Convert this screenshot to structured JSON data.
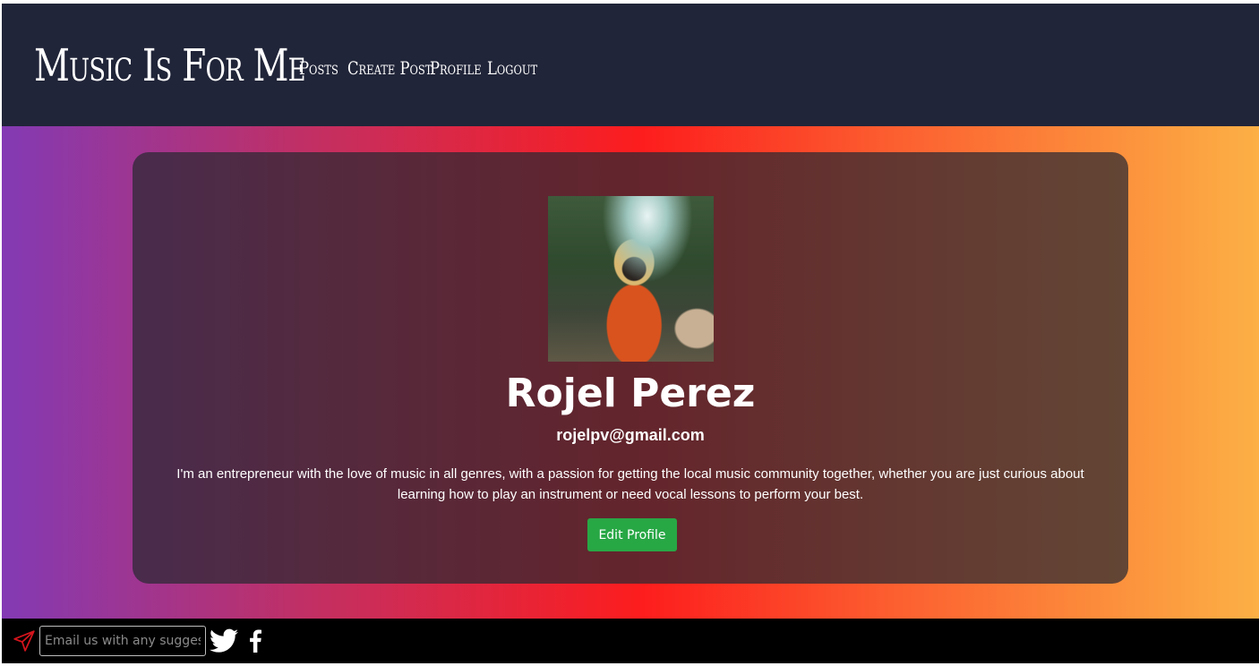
{
  "header": {
    "brand": "Music Is For Me",
    "nav": {
      "posts": "Posts",
      "create_post": "Create Post",
      "profile": "Profile",
      "logout": "Logout"
    }
  },
  "profile": {
    "name": "Rojel Perez",
    "email": "rojelpv@gmail.com",
    "bio": "I'm an entrepreneur with the love of music in all genres, with a passion for getting the local music community together, whether you are just curious about learning how to play an instrument or need vocal lessons to perform your best.",
    "edit_label": "Edit Profile"
  },
  "footer": {
    "email_placeholder": "Email us with any suggestions"
  },
  "colors": {
    "header_bg": "#212539",
    "button": "#28a745",
    "send_icon": "#d4141c"
  },
  "icons": [
    "send-icon",
    "twitter-icon",
    "facebook-icon"
  ]
}
